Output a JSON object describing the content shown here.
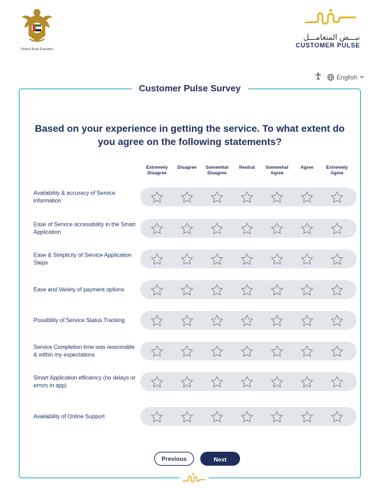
{
  "header": {
    "uae_caption": "United Arab Emirates",
    "brand_arabic": "نبـــض المتعامـــل",
    "brand_english": "CUSTOMER PULSE",
    "language": "English"
  },
  "survey": {
    "title": "Customer Pulse Survey",
    "question": "Based on your experience in getting the service. To what extent do you agree on the following statements?",
    "scale": [
      "Extremely Disagree",
      "Disagree",
      "Somewhat Disagree",
      "Neutral",
      "Somewhat Agree",
      "Agree",
      "Extremely Agree"
    ],
    "statements": [
      "Availability & accuracy of Service information",
      "Ease of Service accessibility in the Smart Application",
      "Ease & Simplicity of Service Application Steps",
      "Ease and Variety of payment options",
      "Possibility of Service Status Tracking",
      "Service Completion time was reasonable & within my expectations",
      "Smart Application efficiency (no delays or errors in app)",
      "Availability of Online Support"
    ],
    "previous_label": "Previous",
    "next_label": "Next"
  },
  "colors": {
    "navy": "#1f2d5a",
    "frame_blue": "#1aa4cd",
    "brand_gold": "#e0b526",
    "row_bg": "#e2e5ea"
  }
}
